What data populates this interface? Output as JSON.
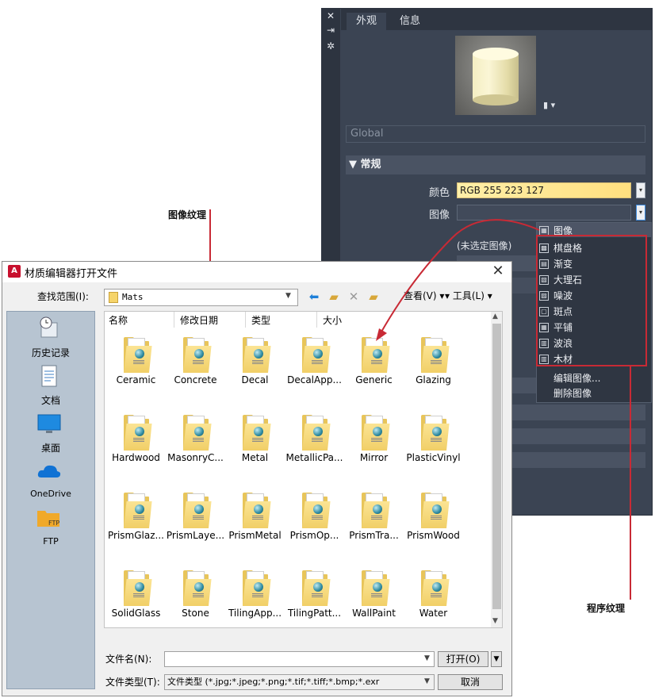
{
  "annotations": {
    "image_texture": "图像纹理",
    "procedural_texture": "程序纹理"
  },
  "material_panel": {
    "tabs": [
      "外观",
      "信息"
    ],
    "material_name": "Global",
    "section_general": "常规",
    "color_label": "颜色",
    "color_value": "RGB 255 223 127",
    "image_label": "图像",
    "no_image_text": "(未选定图像)",
    "image_menu": {
      "header": "图像",
      "procedural_items": [
        "棋盘格",
        "渐变",
        "大理石",
        "噪波",
        "斑点",
        "平铺",
        "波浪",
        "木材"
      ],
      "edit_image": "编辑图像...",
      "delete_image": "删除图像"
    },
    "colors": {
      "panel_bg": "#3b4453",
      "highlight_red": "#c82a35",
      "color_swatch": "#ffdf7f"
    }
  },
  "file_dialog": {
    "title": "材质编辑器打开文件",
    "look_in_label": "查找范围(I):",
    "look_in_value": "Mats",
    "view_menu": "查看(V)",
    "tools_menu": "工具(L)",
    "places": [
      "历史记录",
      "文档",
      "桌面",
      "OneDrive",
      "FTP"
    ],
    "columns": [
      "名称",
      "修改日期",
      "类型",
      "大小"
    ],
    "folders": [
      "Ceramic",
      "Concrete",
      "Decal",
      "DecalApp...",
      "Generic",
      "Glazing",
      "Hardwood",
      "MasonryC...",
      "Metal",
      "MetallicPa...",
      "Mirror",
      "PlasticVinyl",
      "PrismGlaz...",
      "PrismLaye...",
      "PrismMetal",
      "PrismOp...",
      "PrismTra...",
      "PrismWood",
      "SolidGlass",
      "Stone",
      "TilingApp...",
      "TilingPatt...",
      "WallPaint",
      "Water"
    ],
    "file_name_label": "文件名(N):",
    "file_name_value": "",
    "file_type_label": "文件类型(T):",
    "file_type_value": "文件类型 (*.jpg;*.jpeg;*.png;*.tif;*.tiff;*.bmp;*.exr",
    "open_button": "打开(O)",
    "cancel_button": "取消"
  }
}
